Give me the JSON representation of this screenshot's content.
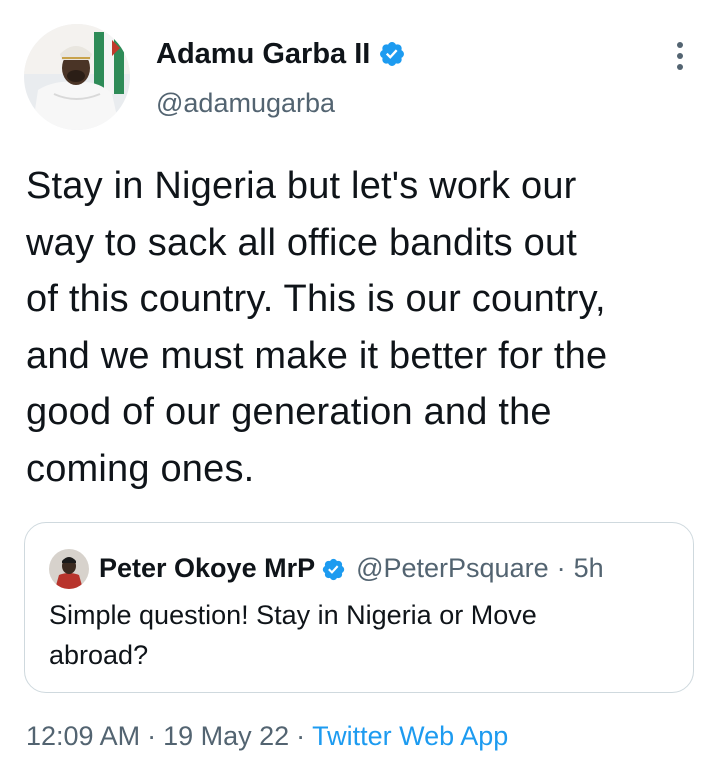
{
  "author": {
    "name": "Adamu Garba II",
    "handle": "@adamugarba",
    "verified": true
  },
  "tweet": {
    "text_lines": [
      "Stay in Nigeria but let's work our",
      "way to sack all office bandits out",
      "of this country. This is our country,",
      "and we must make it better for the",
      "good of our generation and the",
      "coming ones."
    ]
  },
  "quoted_tweet": {
    "author_name": "Peter Okoye MrP",
    "handle": "@PeterPsquare",
    "separator": "·",
    "time": "5h",
    "verified": true,
    "text_lines": [
      "Simple question! Stay in Nigeria or Move",
      "abroad?"
    ]
  },
  "meta": {
    "time": "12:09 AM",
    "sep1": "·",
    "date": "19 May 22",
    "sep2": "·",
    "source": "Twitter Web App"
  },
  "icons": {
    "verified": "verified-badge-icon",
    "more": "more-vertical-icon"
  },
  "colors": {
    "accent": "#1d9bf0",
    "secondary_text": "#536471",
    "border": "#cfd9de",
    "text": "#0f1419"
  }
}
